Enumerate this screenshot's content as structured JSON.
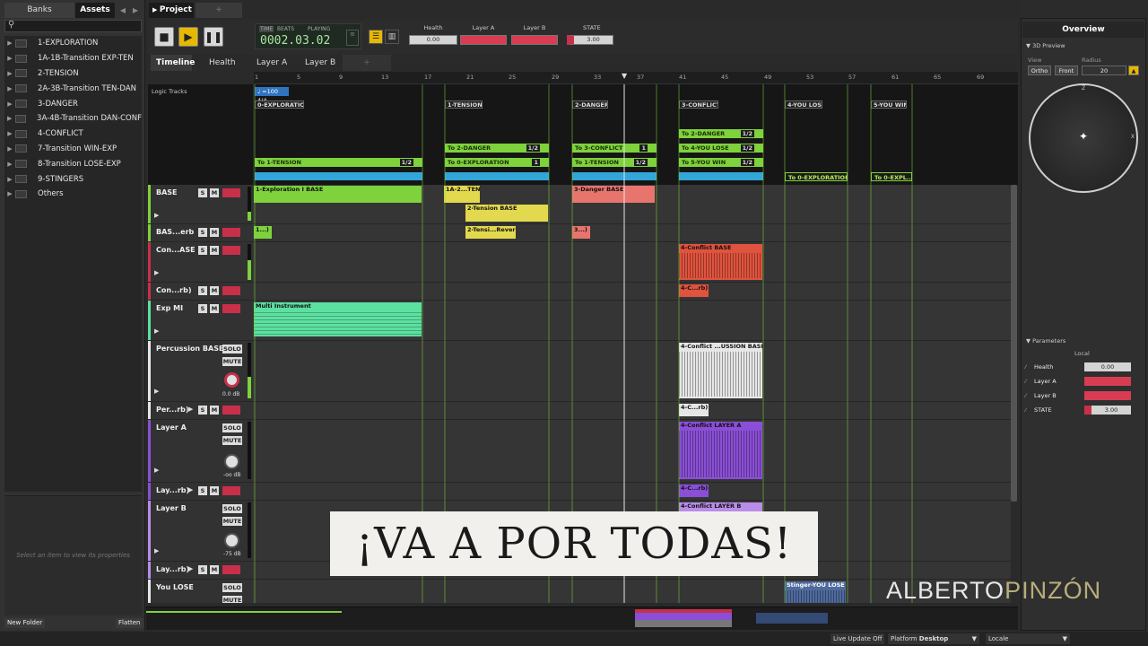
{
  "left_panel": {
    "tabs": [
      "Banks",
      "Assets"
    ],
    "active_tab": "Assets",
    "items": [
      "1-EXPLORATION",
      "1A-1B-Transition EXP-TEN",
      "2-TENSION",
      "2A-3B-Transition TEN-DAN",
      "3-DANGER",
      "3A-4B-Transition DAN-CONF",
      "4-CONFLICT",
      "7-Transition WIN-EXP",
      "8-Transition LOSE-EXP",
      "9-STINGERS",
      "Others"
    ],
    "props_hint": "Select an item to view its properties",
    "new_folder": "New Folder",
    "flatten": "Flatten"
  },
  "project_tab": "Project",
  "transport": {
    "time": "TIME",
    "beats": "BEATS",
    "state": "PLAYING",
    "position": "0002.03.02"
  },
  "parameters_top": [
    {
      "label": "Health",
      "value": "0.00",
      "style": "light"
    },
    {
      "label": "Layer A",
      "value": "-30.0",
      "style": "red"
    },
    {
      "label": "Layer B",
      "value": "-30.0",
      "style": "red"
    },
    {
      "label": "STATE",
      "value": "3.00",
      "style": "light"
    }
  ],
  "subtabs": [
    "Timeline",
    "Health",
    "Layer A",
    "Layer B"
  ],
  "ruler": [
    "1",
    "5",
    "9",
    "13",
    "17",
    "21",
    "25",
    "29",
    "33",
    "37",
    "41",
    "45",
    "49",
    "53",
    "57",
    "61",
    "65",
    "69"
  ],
  "logic": {
    "label": "Logic Tracks",
    "tempo": "♩ =100 4/4",
    "destinations": [
      "0-EXPLORATION",
      "1-TENSION",
      "2-DANGER",
      "3-CONFLICT",
      "4-YOU LOSE",
      "5-YOU WIN"
    ],
    "transitions": [
      {
        "text": "To 1-TENSION",
        "badge": "1/2"
      },
      {
        "text": "To 2-DANGER",
        "badge": "1/2"
      },
      {
        "text": "To 0-EXPLORATION",
        "badge": "1"
      },
      {
        "text": "To 3-CONFLICT",
        "badge": "1"
      },
      {
        "text": "To 1-TENSION",
        "badge": "1/2"
      },
      {
        "text": "To 2-DANGER",
        "badge": "1/2"
      },
      {
        "text": "To 4-YOU LOSE",
        "badge": "1/2"
      },
      {
        "text": "To 5-YOU WIN",
        "badge": "1/2"
      },
      {
        "text": "To 0-EXPLORATION",
        "badge": ""
      },
      {
        "text": "To 0-EXPL...",
        "badge": ""
      }
    ]
  },
  "tracks": [
    {
      "name": "BASE",
      "solo": "S",
      "mute": "M"
    },
    {
      "name": "BAS...erb",
      "solo": "S",
      "mute": "M"
    },
    {
      "name": "Con...ASE",
      "solo": "S",
      "mute": "M"
    },
    {
      "name": "Con...rb)",
      "solo": "S",
      "mute": "M"
    },
    {
      "name": "Exp MI",
      "solo": "S",
      "mute": "M"
    },
    {
      "name": "Percussion BASE",
      "solo": "SOLO",
      "mute": "MUTE",
      "db": "0.0 dB"
    },
    {
      "name": "Per...rb)",
      "solo": "S",
      "mute": "M"
    },
    {
      "name": "Layer A",
      "solo": "SOLO",
      "mute": "MUTE",
      "db": "-oo dB"
    },
    {
      "name": "Lay...rb)",
      "solo": "S",
      "mute": "M"
    },
    {
      "name": "Layer B",
      "solo": "SOLO",
      "mute": "MUTE",
      "db": "-75 dB"
    },
    {
      "name": "Lay...rb)",
      "solo": "S",
      "mute": "M"
    },
    {
      "name": "You LOSE",
      "solo": "SOLO",
      "mute": "MUTE"
    }
  ],
  "regions": {
    "r1": "1-Exploration I BASE",
    "r2": "1A-2...TEN",
    "r3": "2-Tension BASE",
    "r4": "3-Danger BASE",
    "r5": "1...)",
    "r6": "2-Tensi...Reverb)",
    "r7": "3...)",
    "r8": "4-Conflict BASE",
    "r9": "4-C...rb)",
    "r10": "Multi Instrument",
    "r11": "4-Conflict ...USSION BASE",
    "r12": "4-C...rb)",
    "r13": "4-Conflict LAYER A",
    "r14": "4-C...rb)",
    "r15": "4-Conflict LAYER B",
    "r16": "Stinger-YOU LOSE"
  },
  "right_panel": {
    "title": "Overview",
    "preview": "3D Preview",
    "view_label": "View",
    "radius_label": "Radius",
    "ortho": "Ortho",
    "front": "Front",
    "radius": "20",
    "axis_z": "Z",
    "axis_x": "X",
    "parameters_title": "Parameters",
    "local": "Local",
    "params": [
      {
        "label": "Health",
        "value": "0.00"
      },
      {
        "label": "Layer A",
        "value": "-30.0"
      },
      {
        "label": "Layer B",
        "value": "-30.0"
      },
      {
        "label": "STATE",
        "value": "3.00"
      }
    ]
  },
  "status": {
    "live_update": "Live Update Off",
    "platform_label": "Platform",
    "platform": "Desktop",
    "locale": "Locale"
  },
  "overlay": {
    "banner": "¡VA A POR TODAS!",
    "wm_a": "ALBERTO",
    "wm_b": "PINZÓN"
  },
  "colors": {
    "green": "#7ed23b",
    "red": "#c8304a",
    "blue": "#33a6d9",
    "purple": "#8a4fd6"
  }
}
